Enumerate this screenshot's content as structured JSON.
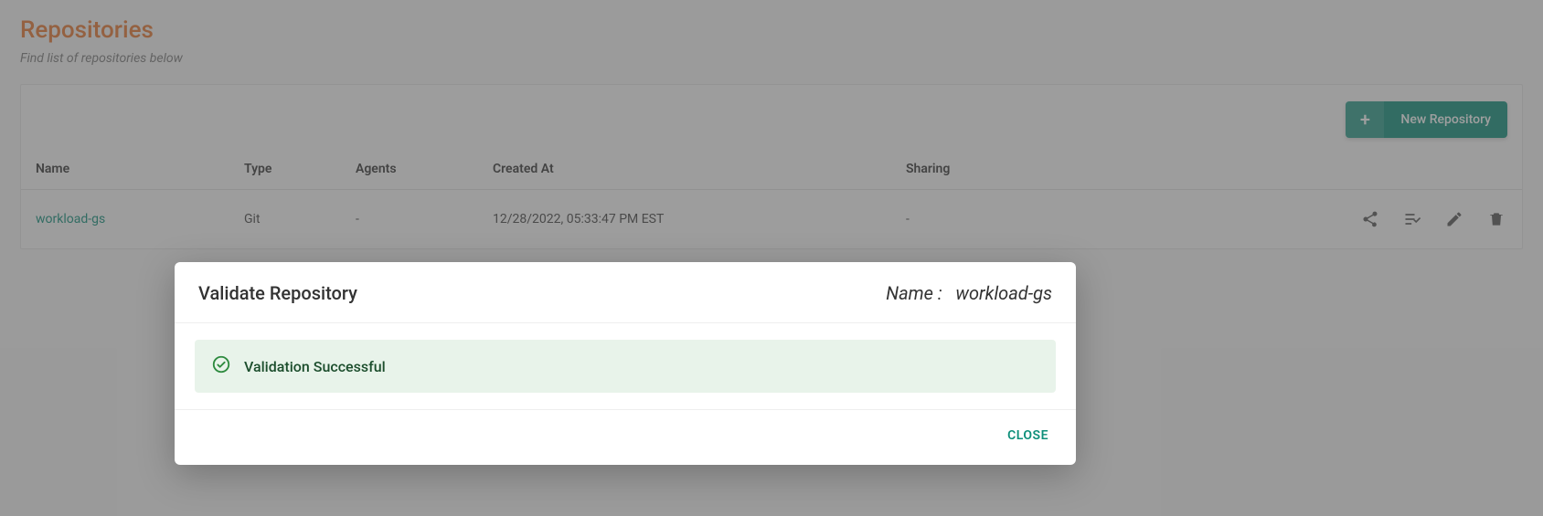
{
  "page": {
    "title": "Repositories",
    "subtitle": "Find list of repositories below"
  },
  "toolbar": {
    "new_label": "New Repository"
  },
  "table": {
    "headers": {
      "name": "Name",
      "type": "Type",
      "agents": "Agents",
      "created_at": "Created At",
      "sharing": "Sharing"
    },
    "rows": [
      {
        "name": "workload-gs",
        "type": "Git",
        "agents": "-",
        "created_at": "12/28/2022, 05:33:47 PM EST",
        "sharing": "-"
      }
    ],
    "action_icons": {
      "share": "share-icon",
      "checklist": "checklist-icon",
      "edit": "pencil-icon",
      "delete": "trash-icon"
    }
  },
  "dialog": {
    "title": "Validate Repository",
    "name_label": "Name :",
    "name_value": "workload-gs",
    "alert_text": "Validation Successful",
    "close_label": "Close"
  }
}
